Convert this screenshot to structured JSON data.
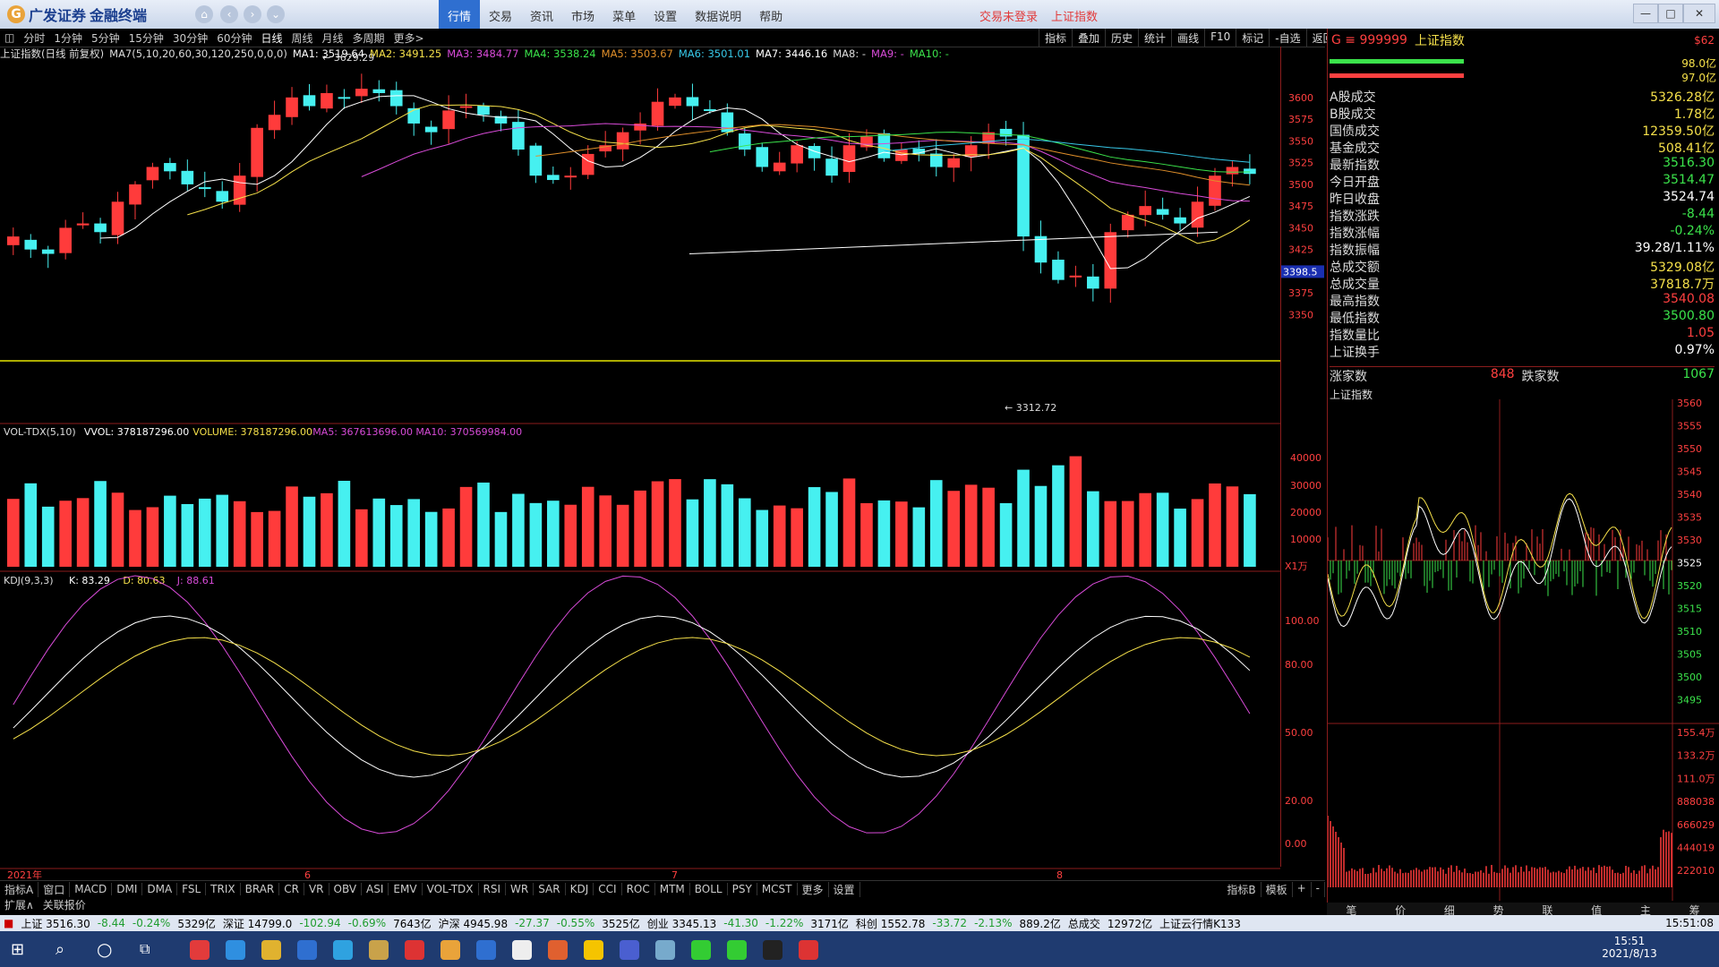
{
  "titlebar": {
    "logo_text": "广发证券",
    "logo_sub": "金融终端",
    "menu": [
      "行情",
      "交易",
      "资讯",
      "市场",
      "菜单",
      "设置",
      "数据说明",
      "帮助"
    ],
    "active_menu": "行情",
    "status_login": "交易未登录",
    "status_index": "上证指数"
  },
  "periods": [
    "分时",
    "1分钟",
    "5分钟",
    "15分钟",
    "30分钟",
    "60分钟",
    "日线",
    "周线",
    "月线",
    "多周期",
    "更多>"
  ],
  "selected_period": "日线",
  "tools": [
    "指标",
    "叠加",
    "历史",
    "统计",
    "画线",
    "F10",
    "标记",
    "-自选",
    "返回"
  ],
  "ma_line": {
    "title": "上证指数(日线 前复权)",
    "items": [
      {
        "text": "MA7(5,10,20,60,30,120,250,0,0,0)",
        "color": "#dddddd"
      },
      {
        "text": "MA1: 3519.64",
        "color": "#ffffff"
      },
      {
        "text": "MA2: 3491.25",
        "color": "#f5e04a"
      },
      {
        "text": "MA3: 3484.77",
        "color": "#d84bd8"
      },
      {
        "text": "MA4: 3538.24",
        "color": "#3be34b"
      },
      {
        "text": "MA5: 3503.67",
        "color": "#e08f2a"
      },
      {
        "text": "MA6: 3501.01",
        "color": "#37c8e8"
      },
      {
        "text": "MA7: 3446.16",
        "color": "#ffffff"
      },
      {
        "text": "MA8: -",
        "color": "#dddddd"
      },
      {
        "text": "MA9: -",
        "color": "#d84bd8"
      },
      {
        "text": "MA10: -",
        "color": "#3be34b"
      }
    ]
  },
  "main_chart": {
    "high_label": "3629.29",
    "low_label": "3312.72",
    "cursor_price": "3398.5",
    "price_ticks": [
      "3600",
      "3575",
      "3550",
      "3525",
      "3500",
      "3475",
      "3450",
      "3425",
      "3375",
      "3350"
    ]
  },
  "volume_panel": {
    "title": "VOL-TDX(5,10)",
    "vol": "VVOL: 378187296.00",
    "volume": "VOLUME: 378187296.00",
    "ma5": "MA5: 367613696.00",
    "ma10": "MA10: 370569984.00",
    "ticks": [
      "40000",
      "30000",
      "20000",
      "10000"
    ],
    "unit": "X1万"
  },
  "kdj_panel": {
    "title": "KDJ(9,3,3)",
    "k": "K: 83.29",
    "d": "D: 80.63",
    "j": "J: 88.61",
    "ticks": [
      "100.00",
      "80.00",
      "50.00",
      "20.00",
      "0.00"
    ]
  },
  "date_axis": {
    "labels": [
      "2021年",
      "6",
      "7",
      "8"
    ],
    "period": "日线"
  },
  "indicators": [
    "指标A",
    "窗口",
    "MACD",
    "DMI",
    "DMA",
    "FSL",
    "TRIX",
    "BRAR",
    "CR",
    "VR",
    "OBV",
    "ASI",
    "EMV",
    "VOL-TDX",
    "RSI",
    "WR",
    "SAR",
    "KDJ",
    "CCI",
    "ROC",
    "MTM",
    "BOLL",
    "PSY",
    "MCST",
    "更多",
    "设置"
  ],
  "indicator_right": [
    "指标B",
    "模板",
    "+",
    "-"
  ],
  "indicator_row2": [
    "扩展∧",
    "关联报价"
  ],
  "right_panel": {
    "code": "G ≡ 999999",
    "name": "上证指数",
    "badge": "$62",
    "bar_vals": [
      "98.0亿",
      "97.0亿"
    ],
    "rows": [
      {
        "label": "A股成交",
        "value": "5326.28亿",
        "color": "#f5e04a"
      },
      {
        "label": "B股成交",
        "value": "1.78亿",
        "color": "#f5e04a"
      },
      {
        "label": "国债成交",
        "value": "12359.50亿",
        "color": "#f5e04a"
      },
      {
        "label": "基金成交",
        "value": "508.41亿",
        "color": "#f5e04a"
      },
      {
        "label": "最新指数",
        "value": "3516.30",
        "color": "#3be34b"
      },
      {
        "label": "今日开盘",
        "value": "3514.47",
        "color": "#3be34b"
      },
      {
        "label": "昨日收盘",
        "value": "3524.74",
        "color": "#ffffff"
      },
      {
        "label": "指数涨跌",
        "value": "-8.44",
        "color": "#3be34b"
      },
      {
        "label": "指数涨幅",
        "value": "-0.24%",
        "color": "#3be34b"
      },
      {
        "label": "指数振幅",
        "value": "39.28/1.11%",
        "color": "#ffffff"
      },
      {
        "label": "总成交额",
        "value": "5329.08亿",
        "color": "#f5e04a"
      },
      {
        "label": "总成交量",
        "value": "37818.7万",
        "color": "#f5e04a"
      },
      {
        "label": "最高指数",
        "value": "3540.08",
        "color": "#ff4040"
      },
      {
        "label": "最低指数",
        "value": "3500.80",
        "color": "#3be34b"
      },
      {
        "label": "指数量比",
        "value": "1.05",
        "color": "#ff4040"
      },
      {
        "label": "上证换手",
        "value": "0.97%",
        "color": "#ffffff"
      }
    ],
    "up_label": "涨家数",
    "up_value": "848",
    "down_label": "跌家数",
    "down_value": "1067",
    "mini_title": "上证指数",
    "mini_price_ticks": [
      "3560",
      "3555",
      "3550",
      "3545",
      "3540",
      "3535",
      "3530",
      "3525",
      "3520",
      "3515",
      "3510",
      "3505",
      "3500",
      "3495"
    ],
    "mini_vol_ticks": [
      "155.4万",
      "133.2万",
      "111.0万",
      "888038",
      "666029",
      "444019",
      "222010"
    ],
    "tabs": [
      "笔",
      "价",
      "细",
      "势",
      "联",
      "值",
      "主",
      "筹"
    ]
  },
  "ticker": [
    {
      "text": "上证 3516.30",
      "color": "#000000"
    },
    {
      "text": "-8.44",
      "color": "#1f9d2f"
    },
    {
      "text": "-0.24%",
      "color": "#1f9d2f"
    },
    {
      "text": "5329亿",
      "color": "#000000"
    },
    {
      "text": "深证 14799.0",
      "color": "#000000"
    },
    {
      "text": "-102.94",
      "color": "#1f9d2f"
    },
    {
      "text": "-0.69%",
      "color": "#1f9d2f"
    },
    {
      "text": "7643亿",
      "color": "#000000"
    },
    {
      "text": "沪深 4945.98",
      "color": "#000000"
    },
    {
      "text": "-27.37",
      "color": "#1f9d2f"
    },
    {
      "text": "-0.55%",
      "color": "#1f9d2f"
    },
    {
      "text": "3525亿",
      "color": "#000000"
    },
    {
      "text": "创业 3345.13",
      "color": "#000000"
    },
    {
      "text": "-41.30",
      "color": "#1f9d2f"
    },
    {
      "text": "-1.22%",
      "color": "#1f9d2f"
    },
    {
      "text": "3171亿",
      "color": "#000000"
    },
    {
      "text": "科创 1552.78",
      "color": "#000000"
    },
    {
      "text": "-33.72",
      "color": "#1f9d2f"
    },
    {
      "text": "-2.13%",
      "color": "#1f9d2f"
    },
    {
      "text": "889.2亿",
      "color": "#000000"
    },
    {
      "text": "总成交",
      "color": "#000000"
    },
    {
      "text": "12972亿",
      "color": "#000000"
    },
    {
      "text": "上证云行情K133",
      "color": "#000000"
    }
  ],
  "ticker_time": "15:51:08",
  "clock": {
    "time": "15:51",
    "date": "2021/8/13"
  }
}
